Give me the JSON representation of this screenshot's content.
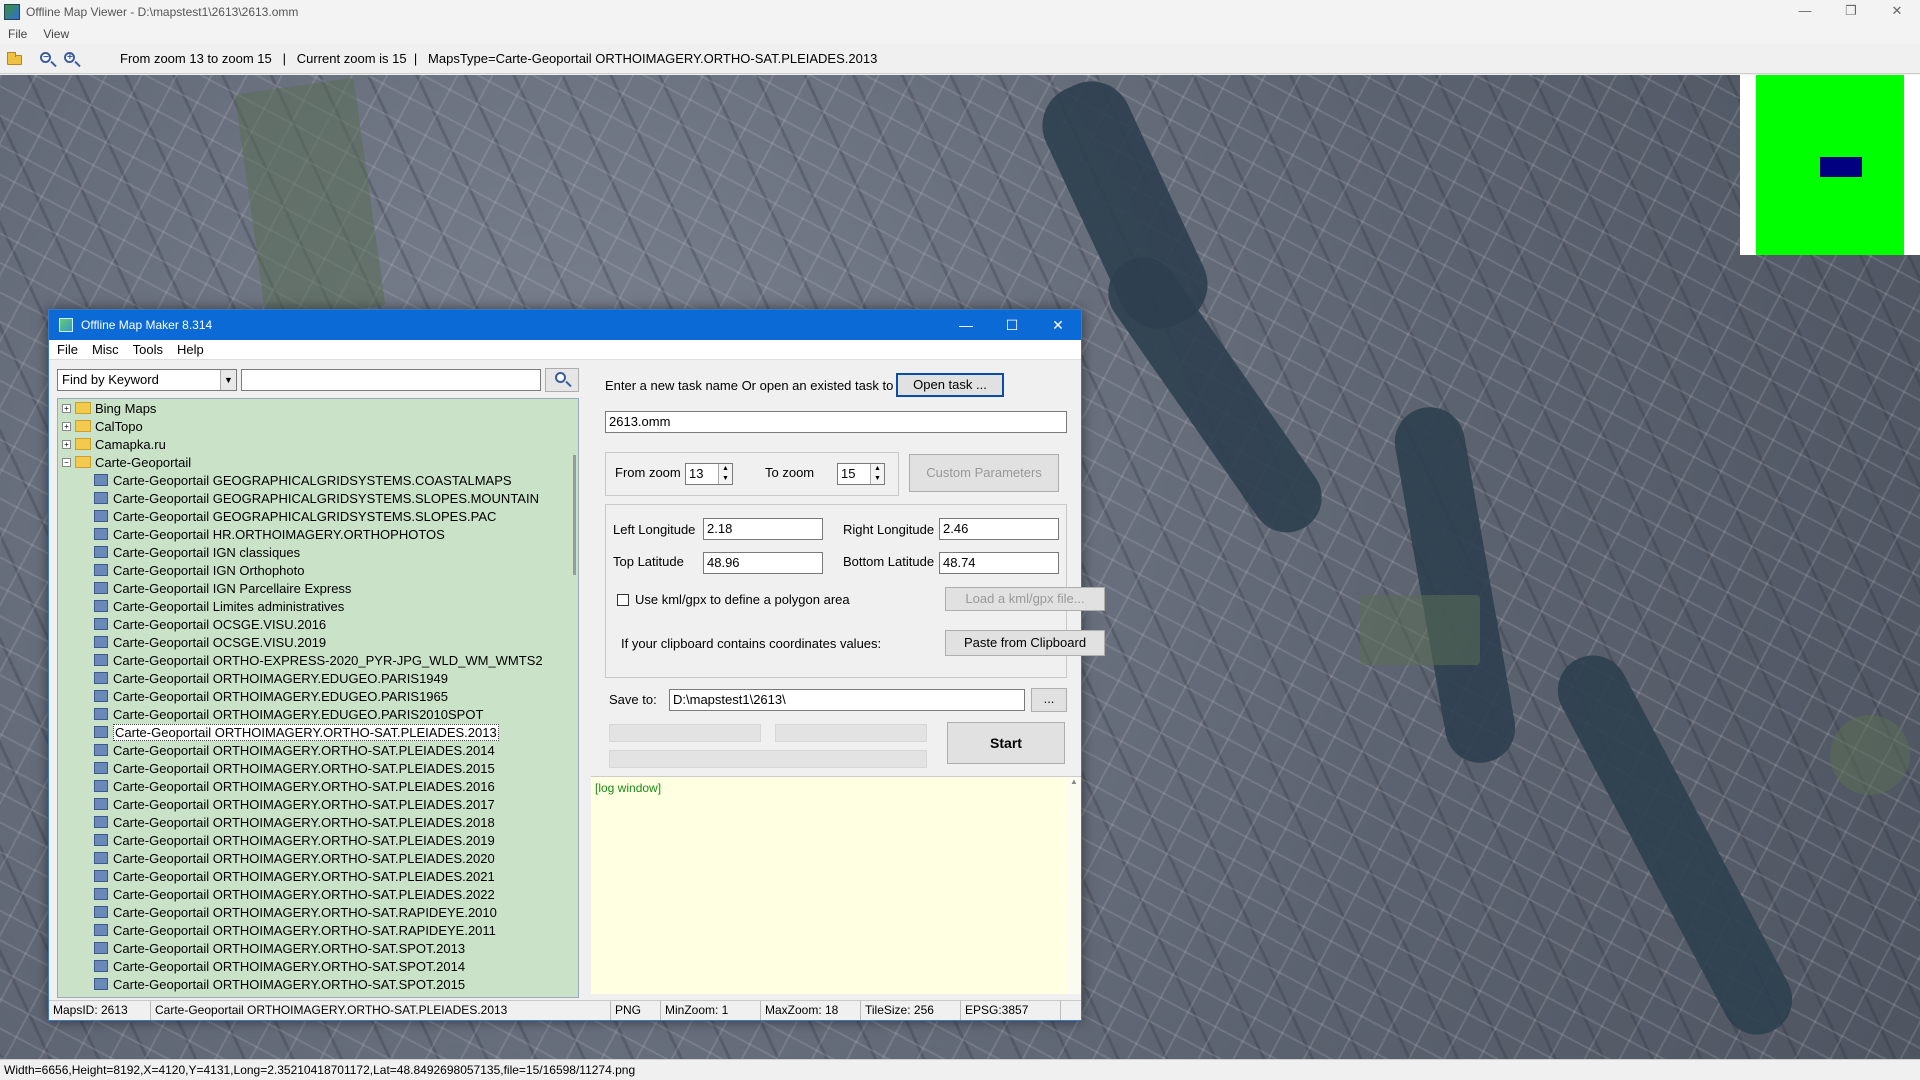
{
  "viewer": {
    "title": "Offline Map Viewer - D:\\mapstest1\\2613\\2613.omm",
    "menu": [
      "File",
      "View"
    ],
    "window_controls": [
      "—",
      "❐",
      "✕"
    ],
    "toolbar_status": "From zoom 13 to zoom 15   |   Current zoom is 15  |   MapsType=Carte-Geoportail ORTHOIMAGERY.ORTHO-SAT.PLEIADES.2013",
    "bottom_status": "Width=6656,Height=8192,X=4120,Y=4131,Long=2.35210418701172,Lat=48.8492698057135,file=15/16598/11274.png",
    "overview_colors": {
      "background": "#00ff00",
      "viewport": "#000080"
    }
  },
  "dialog": {
    "title": "Offline Map Maker 8.314",
    "window_controls": [
      "—",
      "☐",
      "✕"
    ],
    "menu": [
      "File",
      "Misc",
      "Tools",
      "Help"
    ],
    "search": {
      "mode": "Find by Keyword",
      "value": ""
    },
    "tree": {
      "folders": [
        {
          "label": "Bing Maps",
          "expanded": false
        },
        {
          "label": "CalTopo",
          "expanded": false
        },
        {
          "label": "Camapka.ru",
          "expanded": false
        },
        {
          "label": "Carte-Geoportail",
          "expanded": true
        }
      ],
      "children": [
        "Carte-Geoportail GEOGRAPHICALGRIDSYSTEMS.COASTALMAPS",
        "Carte-Geoportail GEOGRAPHICALGRIDSYSTEMS.SLOPES.MOUNTAIN",
        "Carte-Geoportail GEOGRAPHICALGRIDSYSTEMS.SLOPES.PAC",
        "Carte-Geoportail HR.ORTHOIMAGERY.ORTHOPHOTOS",
        "Carte-Geoportail IGN classiques",
        "Carte-Geoportail IGN Orthophoto",
        "Carte-Geoportail IGN Parcellaire Express",
        "Carte-Geoportail Limites administratives",
        "Carte-Geoportail OCSGE.VISU.2016",
        "Carte-Geoportail OCSGE.VISU.2019",
        "Carte-Geoportail ORTHO-EXPRESS-2020_PYR-JPG_WLD_WM_WMTS2",
        "Carte-Geoportail ORTHOIMAGERY.EDUGEO.PARIS1949",
        "Carte-Geoportail ORTHOIMAGERY.EDUGEO.PARIS1965",
        "Carte-Geoportail ORTHOIMAGERY.EDUGEO.PARIS2010SPOT",
        "Carte-Geoportail ORTHOIMAGERY.ORTHO-SAT.PLEIADES.2013",
        "Carte-Geoportail ORTHOIMAGERY.ORTHO-SAT.PLEIADES.2014",
        "Carte-Geoportail ORTHOIMAGERY.ORTHO-SAT.PLEIADES.2015",
        "Carte-Geoportail ORTHOIMAGERY.ORTHO-SAT.PLEIADES.2016",
        "Carte-Geoportail ORTHOIMAGERY.ORTHO-SAT.PLEIADES.2017",
        "Carte-Geoportail ORTHOIMAGERY.ORTHO-SAT.PLEIADES.2018",
        "Carte-Geoportail ORTHOIMAGERY.ORTHO-SAT.PLEIADES.2019",
        "Carte-Geoportail ORTHOIMAGERY.ORTHO-SAT.PLEIADES.2020",
        "Carte-Geoportail ORTHOIMAGERY.ORTHO-SAT.PLEIADES.2021",
        "Carte-Geoportail ORTHOIMAGERY.ORTHO-SAT.PLEIADES.2022",
        "Carte-Geoportail ORTHOIMAGERY.ORTHO-SAT.RAPIDEYE.2010",
        "Carte-Geoportail ORTHOIMAGERY.ORTHO-SAT.RAPIDEYE.2011",
        "Carte-Geoportail ORTHOIMAGERY.ORTHO-SAT.SPOT.2013",
        "Carte-Geoportail ORTHOIMAGERY.ORTHO-SAT.SPOT.2014",
        "Carte-Geoportail ORTHOIMAGERY.ORTHO-SAT.SPOT.2015"
      ],
      "selected": "Carte-Geoportail ORTHOIMAGERY.ORTHO-SAT.PLEIADES.2013"
    },
    "task": {
      "prompt": "Enter a new task name Or open an existed task to continue:",
      "open_button": "Open task ...",
      "name": "2613.omm"
    },
    "zoom": {
      "from_label": "From zoom",
      "from_value": "13",
      "to_label": "To zoom",
      "to_value": "15",
      "custom_button": "Custom Parameters"
    },
    "bounds": {
      "left_label": "Left Longitude",
      "left_value": "2.18",
      "right_label": "Right Longitude",
      "right_value": "2.46",
      "top_label": "Top Latitude",
      "top_value": "48.96",
      "bottom_label": "Bottom Latitude",
      "bottom_value": "48.74",
      "kml_label": "Use kml/gpx to define a polygon area",
      "kml_checked": false,
      "kml_button": "Load a kml/gpx file...",
      "clipboard_label": "If your clipboard contains coordinates values:",
      "clipboard_button": "Paste from Clipboard"
    },
    "save": {
      "label": "Save to:",
      "path": "D:\\mapstest1\\2613\\",
      "browse": "..."
    },
    "start_button": "Start",
    "log": "[log window]",
    "status": {
      "maps_id": "MapsID: 2613",
      "maps_name": "Carte-Geoportail ORTHOIMAGERY.ORTHO-SAT.PLEIADES.2013",
      "format": "PNG",
      "min_zoom": "MinZoom: 1",
      "max_zoom": "MaxZoom: 18",
      "tile_size": "TileSize: 256",
      "epsg": "EPSG:3857"
    }
  }
}
